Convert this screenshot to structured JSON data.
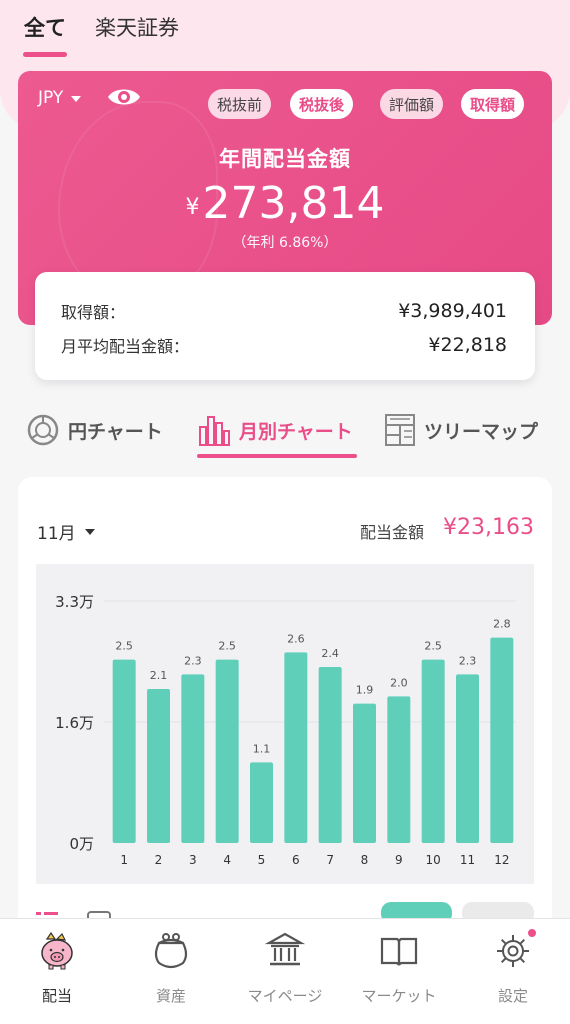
{
  "top_tabs": [
    {
      "label": "全て",
      "active": true
    },
    {
      "label": "楽天証券",
      "active": false
    }
  ],
  "hero": {
    "currency": "JPY",
    "pills": [
      {
        "label": "税抜前",
        "active": false
      },
      {
        "label": "税抜後",
        "active": true
      },
      {
        "label": "評価額",
        "active": false
      },
      {
        "label": "取得額",
        "active": true
      }
    ],
    "title": "年間配当金額",
    "yen_symbol": "¥",
    "amount": "273,814",
    "sub": "（年利 6.86%）",
    "accent_color": "#e94e88"
  },
  "summary": {
    "rows": [
      {
        "label": "取得額：",
        "value": "¥3,989,401"
      },
      {
        "label": "月平均配当金額：",
        "value": "¥22,818"
      }
    ]
  },
  "chart_tabs": [
    {
      "label": "円チャート",
      "icon": "pie-chart-icon",
      "active": false
    },
    {
      "label": "月別チャート",
      "icon": "bar-chart-icon",
      "active": true
    },
    {
      "label": "ツリーマップ",
      "icon": "treemap-icon",
      "active": false
    }
  ],
  "chart_panel": {
    "month_select": "11月",
    "dividend_label": "配当金額",
    "dividend_value": "¥23,163"
  },
  "chart_data": {
    "type": "bar",
    "categories": [
      "1",
      "2",
      "3",
      "4",
      "5",
      "6",
      "7",
      "8",
      "9",
      "10",
      "11",
      "12"
    ],
    "values": [
      2.5,
      2.1,
      2.3,
      2.5,
      1.1,
      2.6,
      2.4,
      1.9,
      2.0,
      2.5,
      2.3,
      2.8
    ],
    "value_labels": [
      "2.5",
      "2.1",
      "2.3",
      "2.5",
      "1.1",
      "2.6",
      "2.4",
      "1.9",
      "2.0",
      "2.5",
      "2.3",
      "2.8"
    ],
    "y_ticks": [
      {
        "value": 0,
        "label": "0万"
      },
      {
        "value": 1.65,
        "label": "1.6万"
      },
      {
        "value": 3.3,
        "label": "3.3万"
      }
    ],
    "ylim": [
      0,
      3.3
    ],
    "title": "",
    "xlabel": "",
    "ylabel": "",
    "bar_color": "#5fcfba",
    "grid": true
  },
  "bottom_nav": [
    {
      "label": "配当",
      "icon": "piggy-bank-icon",
      "active": true
    },
    {
      "label": "資産",
      "icon": "purse-icon",
      "active": false
    },
    {
      "label": "マイページ",
      "icon": "bank-icon",
      "active": false
    },
    {
      "label": "マーケット",
      "icon": "book-icon",
      "active": false
    },
    {
      "label": "設定",
      "icon": "gear-icon",
      "active": false
    }
  ]
}
